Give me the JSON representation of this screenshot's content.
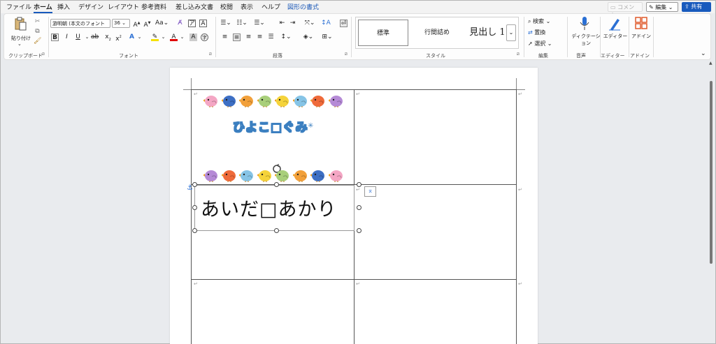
{
  "menu": {
    "tabs": [
      "ファイル",
      "ホーム",
      "挿入",
      "デザイン",
      "レイアウト",
      "参考資料",
      "差し込み文書",
      "校閲",
      "表示",
      "ヘルプ",
      "図形の書式"
    ],
    "comment": "コメント",
    "edit": "編集",
    "share": "共有"
  },
  "ribbon": {
    "clipboard": {
      "paste": "貼り付け",
      "label": "クリップボード"
    },
    "font": {
      "name": "游明朝 (本文のフォント",
      "size": "36",
      "label": "フォント"
    },
    "paragraph": {
      "label": "段落"
    },
    "styles": {
      "items": [
        "標準",
        "行間詰め",
        "見出し 1"
      ],
      "label": "スタイル"
    },
    "editing": {
      "find": "検索",
      "replace": "置換",
      "select": "選択",
      "label": "編集"
    },
    "voice": {
      "dictate": "ディクテーション",
      "label": "音声"
    },
    "editor": {
      "button": "エディター",
      "label": "エディター"
    },
    "addins": {
      "button": "アドイン",
      "label": "アドイン"
    }
  },
  "document": {
    "title_text": "ひよこ□ぐみ",
    "name_text": "あいだ□あかり"
  },
  "colors": {
    "accent": "#185abd",
    "title_outline": "#3b7fc0"
  }
}
